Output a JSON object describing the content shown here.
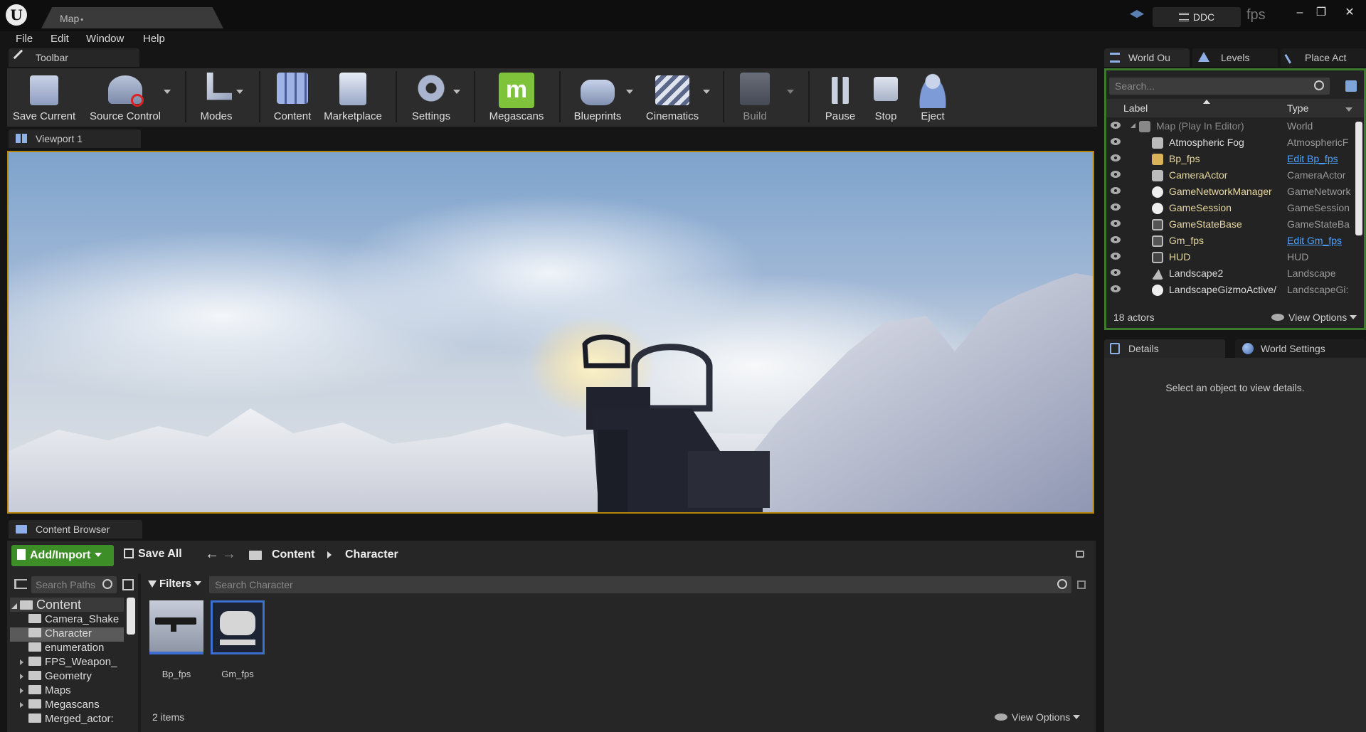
{
  "title_bar": {
    "logo": "U",
    "tab_title": "Map",
    "tab_modified": "•",
    "ddc_label": "DDC",
    "project_name": "fps",
    "minimize_glyph": "–",
    "restore_glyph": "❐",
    "close_glyph": "✕"
  },
  "menu": {
    "items": [
      "File",
      "Edit",
      "Window",
      "Help"
    ]
  },
  "toolbar": {
    "tab_label": "Toolbar",
    "buttons": [
      {
        "label": "Save Current",
        "icon": "save-icon"
      },
      {
        "label": "Source Control",
        "icon": "source-control-icon"
      },
      {
        "label": "Modes",
        "icon": "modes-icon"
      },
      {
        "label": "Content",
        "icon": "content-icon"
      },
      {
        "label": "Marketplace",
        "icon": "marketplace-icon"
      },
      {
        "label": "Settings",
        "icon": "settings-icon"
      },
      {
        "label": "Megascans",
        "icon": "megascans-icon"
      },
      {
        "label": "Blueprints",
        "icon": "blueprints-icon"
      },
      {
        "label": "Cinematics",
        "icon": "cinematics-icon"
      },
      {
        "label": "Build",
        "icon": "build-icon"
      },
      {
        "label": "Pause",
        "icon": "pause-icon"
      },
      {
        "label": "Stop",
        "icon": "stop-icon"
      },
      {
        "label": "Eject",
        "icon": "eject-icon"
      }
    ],
    "megascans_glyph": "m"
  },
  "viewport": {
    "tab_label": "Viewport 1"
  },
  "content_browser": {
    "tab_label": "Content Browser",
    "add_import_label": "Add/Import",
    "save_all_label": "Save All",
    "breadcrumb": [
      "Content",
      "Character"
    ],
    "search_paths_placeholder": "Search Paths",
    "filters_label": "Filters",
    "search_placeholder": "Search Character",
    "tree": [
      {
        "label": "Content",
        "root": true,
        "expanded": true
      },
      {
        "label": "Camera_Shake",
        "selected": false
      },
      {
        "label": "Character",
        "selected": true
      },
      {
        "label": "enumeration",
        "selected": false
      },
      {
        "label": "FPS_Weapon_",
        "collapsed": true
      },
      {
        "label": "Geometry",
        "collapsed": true
      },
      {
        "label": "Maps",
        "collapsed": true
      },
      {
        "label": "Megascans",
        "collapsed": true
      },
      {
        "label": "Merged_actor:",
        "selected": false
      }
    ],
    "assets": [
      {
        "name": "Bp_fps",
        "icon": "rifle-thumbnail-icon"
      },
      {
        "name": "Gm_fps",
        "icon": "gamepad-thumbnail-icon"
      }
    ],
    "item_count": "2 items",
    "view_options_label": "View Options"
  },
  "world_outliner": {
    "tabs": [
      "World Ou",
      "Levels",
      "Place Act"
    ],
    "search_placeholder": "Search...",
    "col_label": "Label",
    "col_type": "Type",
    "rows": [
      {
        "label": "Map (Play In Editor)",
        "type": "World",
        "root": true,
        "link": false
      },
      {
        "label": "Atmospheric Fog",
        "type": "AtmosphericF",
        "link": false
      },
      {
        "label": "Bp_fps",
        "type": "Edit Bp_fps",
        "link": true
      },
      {
        "label": "CameraActor",
        "type": "CameraActor",
        "link": false
      },
      {
        "label": "GameNetworkManager",
        "type": "GameNetwork",
        "link": false
      },
      {
        "label": "GameSession",
        "type": "GameSession",
        "link": false
      },
      {
        "label": "GameStateBase",
        "type": "GameStateBa",
        "link": false
      },
      {
        "label": "Gm_fps",
        "type": "Edit Gm_fps",
        "link": true
      },
      {
        "label": "HUD",
        "type": "HUD",
        "link": false
      },
      {
        "label": "Landscape2",
        "type": "Landscape",
        "link": false
      },
      {
        "label": "LandscapeGizmoActive/",
        "type": "LandscapeGi:",
        "link": false
      }
    ],
    "actor_count": "18 actors",
    "view_options_label": "View Options"
  },
  "details": {
    "tabs": [
      "Details",
      "World Settings"
    ],
    "empty_message": "Select an object to view details."
  },
  "colors": {
    "accent_green": "#3c7a2e",
    "viewport_border": "#b8860b",
    "link_blue": "#4ea2ff",
    "actor_label": "#e6d7a0"
  }
}
